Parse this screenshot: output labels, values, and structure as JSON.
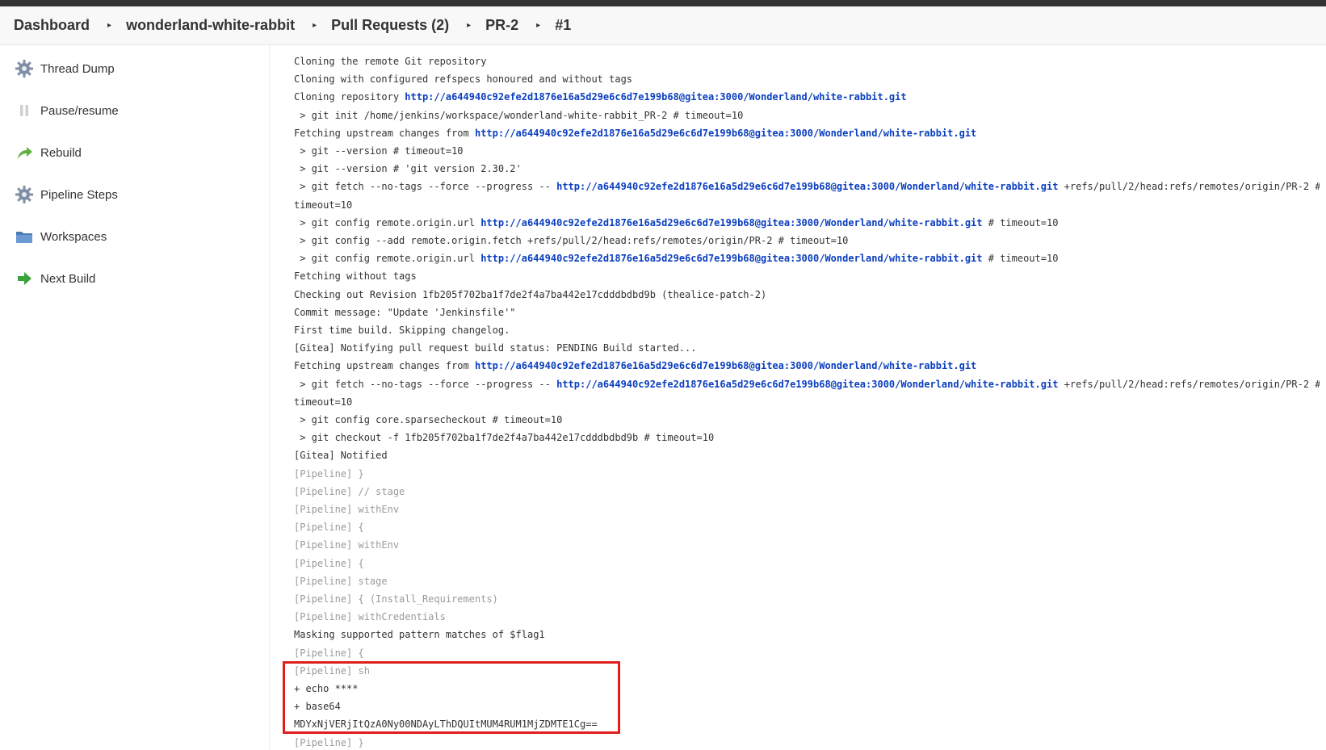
{
  "breadcrumb": {
    "items": [
      "Dashboard",
      "wonderland-white-rabbit",
      "Pull Requests (2)",
      "PR-2",
      "#1"
    ]
  },
  "sidebar": {
    "items": [
      {
        "label": "Thread Dump",
        "icon": "gear-icon"
      },
      {
        "label": "Pause/resume",
        "icon": "pause-icon"
      },
      {
        "label": "Rebuild",
        "icon": "rebuild-arrow-icon"
      },
      {
        "label": "Pipeline Steps",
        "icon": "gear-icon"
      },
      {
        "label": "Workspaces",
        "icon": "folder-icon"
      },
      {
        "label": "Next Build",
        "icon": "green-arrow-icon"
      }
    ]
  },
  "console": {
    "lines": [
      {
        "segments": [
          {
            "t": "Cloning the remote Git repository"
          }
        ]
      },
      {
        "segments": [
          {
            "t": "Cloning with configured refspecs honoured and without tags"
          }
        ]
      },
      {
        "segments": [
          {
            "t": "Cloning repository "
          },
          {
            "t": "http://a644940c92efe2d1876e16a5d29e6c6d7e199b68@gitea:3000/Wonderland/white-rabbit.git",
            "link": true
          }
        ]
      },
      {
        "segments": [
          {
            "t": " > git init /home/jenkins/workspace/wonderland-white-rabbit_PR-2 # timeout=10"
          }
        ]
      },
      {
        "segments": [
          {
            "t": "Fetching upstream changes from "
          },
          {
            "t": "http://a644940c92efe2d1876e16a5d29e6c6d7e199b68@gitea:3000/Wonderland/white-rabbit.git",
            "link": true
          }
        ]
      },
      {
        "segments": [
          {
            "t": " > git --version # timeout=10"
          }
        ]
      },
      {
        "segments": [
          {
            "t": " > git --version # 'git version 2.30.2'"
          }
        ]
      },
      {
        "segments": [
          {
            "t": " > git fetch --no-tags --force --progress -- "
          },
          {
            "t": "http://a644940c92efe2d1876e16a5d29e6c6d7e199b68@gitea:3000/Wonderland/white-rabbit.git",
            "link": true
          },
          {
            "t": " +refs/pull/2/head:refs/remotes/origin/PR-2 #"
          }
        ]
      },
      {
        "segments": [
          {
            "t": "timeout=10"
          }
        ]
      },
      {
        "segments": [
          {
            "t": " > git config remote.origin.url "
          },
          {
            "t": "http://a644940c92efe2d1876e16a5d29e6c6d7e199b68@gitea:3000/Wonderland/white-rabbit.git",
            "link": true
          },
          {
            "t": " # timeout=10"
          }
        ]
      },
      {
        "segments": [
          {
            "t": " > git config --add remote.origin.fetch +refs/pull/2/head:refs/remotes/origin/PR-2 # timeout=10"
          }
        ]
      },
      {
        "segments": [
          {
            "t": " > git config remote.origin.url "
          },
          {
            "t": "http://a644940c92efe2d1876e16a5d29e6c6d7e199b68@gitea:3000/Wonderland/white-rabbit.git",
            "link": true
          },
          {
            "t": " # timeout=10"
          }
        ]
      },
      {
        "segments": [
          {
            "t": "Fetching without tags"
          }
        ]
      },
      {
        "segments": [
          {
            "t": "Checking out Revision 1fb205f702ba1f7de2f4a7ba442e17cdddbdbd9b (thealice-patch-2)"
          }
        ]
      },
      {
        "segments": [
          {
            "t": "Commit message: \"Update 'Jenkinsfile'\""
          }
        ]
      },
      {
        "segments": [
          {
            "t": "First time build. Skipping changelog."
          }
        ]
      },
      {
        "segments": [
          {
            "t": "[Gitea] Notifying pull request build status: PENDING Build started..."
          }
        ]
      },
      {
        "segments": [
          {
            "t": "Fetching upstream changes from "
          },
          {
            "t": "http://a644940c92efe2d1876e16a5d29e6c6d7e199b68@gitea:3000/Wonderland/white-rabbit.git",
            "link": true
          }
        ]
      },
      {
        "segments": [
          {
            "t": " > git fetch --no-tags --force --progress -- "
          },
          {
            "t": "http://a644940c92efe2d1876e16a5d29e6c6d7e199b68@gitea:3000/Wonderland/white-rabbit.git",
            "link": true
          },
          {
            "t": " +refs/pull/2/head:refs/remotes/origin/PR-2 #"
          }
        ]
      },
      {
        "segments": [
          {
            "t": "timeout=10"
          }
        ]
      },
      {
        "segments": [
          {
            "t": " > git config core.sparsecheckout # timeout=10"
          }
        ]
      },
      {
        "segments": [
          {
            "t": " > git checkout -f 1fb205f702ba1f7de2f4a7ba442e17cdddbdbd9b # timeout=10"
          }
        ]
      },
      {
        "segments": [
          {
            "t": "[Gitea] Notified"
          }
        ]
      },
      {
        "gray": true,
        "segments": [
          {
            "t": "[Pipeline] }"
          }
        ]
      },
      {
        "gray": true,
        "segments": [
          {
            "t": "[Pipeline] // stage"
          }
        ]
      },
      {
        "gray": true,
        "segments": [
          {
            "t": "[Pipeline] withEnv"
          }
        ]
      },
      {
        "gray": true,
        "segments": [
          {
            "t": "[Pipeline] {"
          }
        ]
      },
      {
        "gray": true,
        "segments": [
          {
            "t": "[Pipeline] withEnv"
          }
        ]
      },
      {
        "gray": true,
        "segments": [
          {
            "t": "[Pipeline] {"
          }
        ]
      },
      {
        "gray": true,
        "segments": [
          {
            "t": "[Pipeline] stage"
          }
        ]
      },
      {
        "gray": true,
        "segments": [
          {
            "t": "[Pipeline] { (Install_Requirements)"
          }
        ]
      },
      {
        "gray": true,
        "segments": [
          {
            "t": "[Pipeline] withCredentials"
          }
        ]
      },
      {
        "segments": [
          {
            "t": "Masking supported pattern matches of $flag1"
          }
        ]
      },
      {
        "gray": true,
        "segments": [
          {
            "t": "[Pipeline] {"
          }
        ]
      },
      {
        "gray": true,
        "segments": [
          {
            "t": "[Pipeline] sh"
          }
        ]
      },
      {
        "segments": [
          {
            "t": "+ echo ****"
          }
        ]
      },
      {
        "segments": [
          {
            "t": "+ base64"
          }
        ]
      },
      {
        "segments": [
          {
            "t": "MDYxNjVERjItQzA0Ny00NDAyLThDQUItMUM4RUM1MjZDMTE1Cg=="
          }
        ]
      },
      {
        "gray": true,
        "segments": [
          {
            "t": "[Pipeline] }"
          }
        ]
      }
    ]
  },
  "highlight": {
    "color": "#e01e1e"
  },
  "colors": {
    "link": "#0b3fbf",
    "text": "#333333",
    "gray": "#9a9a9a"
  }
}
